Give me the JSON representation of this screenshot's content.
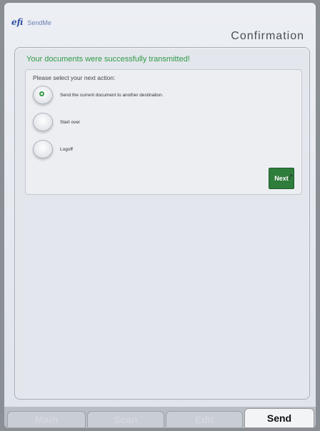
{
  "header": {
    "logo": "efi",
    "app_name": "SendMe",
    "page_title": "Confirmation"
  },
  "main": {
    "success_message": "Your documents were successfully transmitted!",
    "prompt": "Please select your next action:",
    "options": [
      {
        "label": "Send the current document to another destination.",
        "selected": true
      },
      {
        "label": "Start over",
        "selected": false
      },
      {
        "label": "Logoff",
        "selected": false
      }
    ],
    "next_label": "Next"
  },
  "tabs": [
    {
      "label": "Main",
      "active": false
    },
    {
      "label": "Scan",
      "active": false
    },
    {
      "label": "Edit",
      "active": false
    },
    {
      "label": "Send",
      "active": true
    }
  ],
  "colors": {
    "success": "#2f9a44",
    "next_button": "#2f7d3b",
    "brand": "#2f4fa0"
  }
}
